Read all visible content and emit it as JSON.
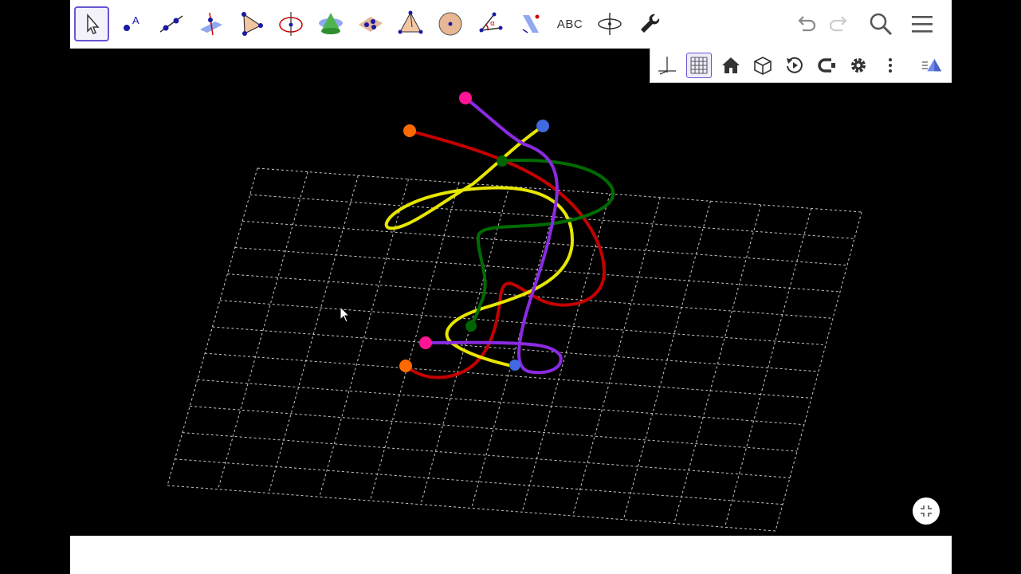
{
  "toolbar": {
    "tools": [
      {
        "name": "move-tool",
        "icon": "arrow-cursor-icon",
        "active": true
      },
      {
        "name": "point-tool",
        "icon": "point-A-icon"
      },
      {
        "name": "line-tool",
        "icon": "line-icon"
      },
      {
        "name": "perpendicular-tool",
        "icon": "perpendicular-plane-icon"
      },
      {
        "name": "polygon-tool",
        "icon": "polygon-icon"
      },
      {
        "name": "circle-axis-tool",
        "icon": "circle-axis-icon"
      },
      {
        "name": "intersect-tool",
        "icon": "cone-icon"
      },
      {
        "name": "plane-tool",
        "icon": "plane-points-icon"
      },
      {
        "name": "pyramid-tool",
        "icon": "pyramid-icon"
      },
      {
        "name": "sphere-tool",
        "icon": "sphere-icon"
      },
      {
        "name": "angle-tool",
        "icon": "angle-icon"
      },
      {
        "name": "reflect-tool",
        "icon": "reflect-plane-icon"
      },
      {
        "name": "text-tool",
        "icon": "text-icon",
        "label": "ABC"
      },
      {
        "name": "rotate-view-tool",
        "icon": "rotate-view-icon"
      },
      {
        "name": "tools-settings",
        "icon": "wrench-icon"
      }
    ],
    "right": [
      "undo-icon",
      "redo-icon",
      "search-icon",
      "menu-icon"
    ]
  },
  "stylebar": [
    "axes-icon",
    "grid-icon",
    "home-icon",
    "cube-icon",
    "rotate-icon",
    "clipping-icon",
    "gear-icon",
    "more-vert-icon",
    "view-icon"
  ],
  "colors": {
    "accent": "#6557d2",
    "red": "#cc0000",
    "yellow": "#ffff00",
    "green": "#006400",
    "purple": "#8a2be2",
    "orange": "#ff6a00",
    "magenta": "#ff00aa",
    "blue": "#4169e1"
  }
}
